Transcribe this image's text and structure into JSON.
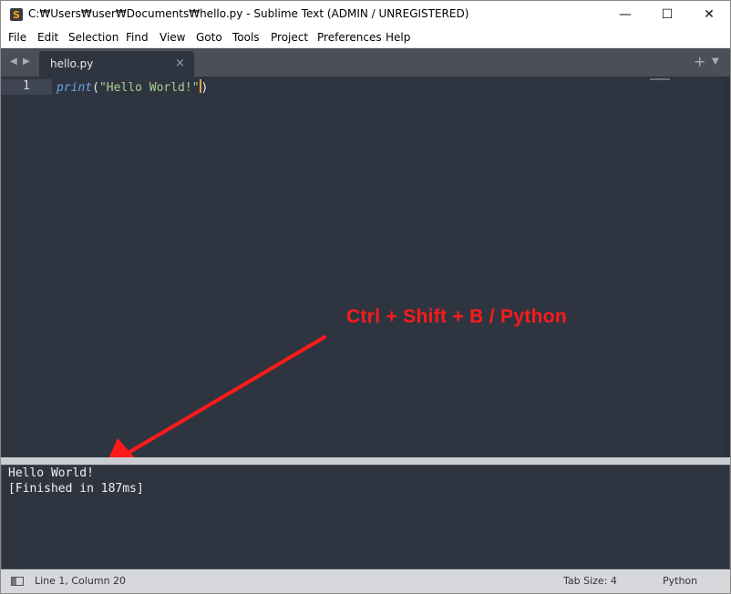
{
  "window": {
    "title": "C:₩Users₩user₩Documents₩hello.py - Sublime Text (ADMIN / UNREGISTERED)",
    "app_icon_glyph": "S",
    "controls": {
      "minimize": "—",
      "maximize": "☐",
      "close": "✕"
    }
  },
  "menu": [
    "File",
    "Edit",
    "Selection",
    "Find",
    "View",
    "Goto",
    "Tools",
    "Project",
    "Preferences",
    "Help"
  ],
  "tabs": {
    "nav_left": "◀",
    "nav_right": "▶",
    "active": {
      "label": "hello.py",
      "close": "×"
    },
    "new_tab": "+",
    "more": "▼"
  },
  "editor": {
    "line_number": "1",
    "code": {
      "func": "print",
      "open_paren": "(",
      "string": "\"Hello World!\"",
      "close_paren": ")"
    }
  },
  "annotation": {
    "text": "Ctrl + Shift + B / Python",
    "color": "#ff1a1a"
  },
  "output": {
    "lines": [
      "Hello World!",
      "[Finished in 187ms]"
    ]
  },
  "status": {
    "position": "Line 1, Column 20",
    "tab_size": "Tab Size: 4",
    "syntax": "Python"
  },
  "icons": {
    "app": "sublime-logo-icon",
    "panel_toggle": "panel-toggle-icon"
  },
  "colors": {
    "editor_bg": "#2f3540",
    "keyword": "#6aa0e6",
    "string": "#a6d08e",
    "cursor": "#f0a030"
  }
}
